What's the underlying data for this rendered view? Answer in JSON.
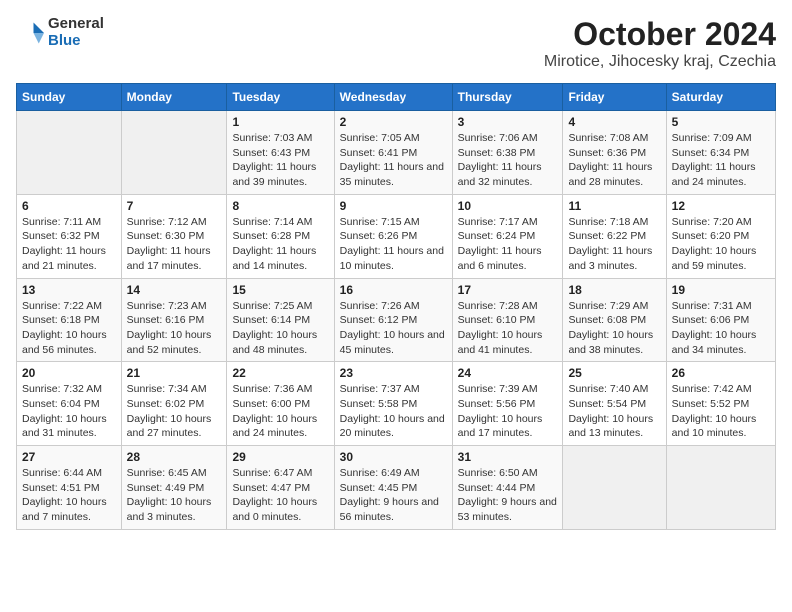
{
  "logo": {
    "general": "General",
    "blue": "Blue"
  },
  "title": "October 2024",
  "subtitle": "Mirotice, Jihocesky kraj, Czechia",
  "days_of_week": [
    "Sunday",
    "Monday",
    "Tuesday",
    "Wednesday",
    "Thursday",
    "Friday",
    "Saturday"
  ],
  "weeks": [
    [
      {
        "num": "",
        "detail": ""
      },
      {
        "num": "",
        "detail": ""
      },
      {
        "num": "1",
        "detail": "Sunrise: 7:03 AM\nSunset: 6:43 PM\nDaylight: 11 hours and 39 minutes."
      },
      {
        "num": "2",
        "detail": "Sunrise: 7:05 AM\nSunset: 6:41 PM\nDaylight: 11 hours and 35 minutes."
      },
      {
        "num": "3",
        "detail": "Sunrise: 7:06 AM\nSunset: 6:38 PM\nDaylight: 11 hours and 32 minutes."
      },
      {
        "num": "4",
        "detail": "Sunrise: 7:08 AM\nSunset: 6:36 PM\nDaylight: 11 hours and 28 minutes."
      },
      {
        "num": "5",
        "detail": "Sunrise: 7:09 AM\nSunset: 6:34 PM\nDaylight: 11 hours and 24 minutes."
      }
    ],
    [
      {
        "num": "6",
        "detail": "Sunrise: 7:11 AM\nSunset: 6:32 PM\nDaylight: 11 hours and 21 minutes."
      },
      {
        "num": "7",
        "detail": "Sunrise: 7:12 AM\nSunset: 6:30 PM\nDaylight: 11 hours and 17 minutes."
      },
      {
        "num": "8",
        "detail": "Sunrise: 7:14 AM\nSunset: 6:28 PM\nDaylight: 11 hours and 14 minutes."
      },
      {
        "num": "9",
        "detail": "Sunrise: 7:15 AM\nSunset: 6:26 PM\nDaylight: 11 hours and 10 minutes."
      },
      {
        "num": "10",
        "detail": "Sunrise: 7:17 AM\nSunset: 6:24 PM\nDaylight: 11 hours and 6 minutes."
      },
      {
        "num": "11",
        "detail": "Sunrise: 7:18 AM\nSunset: 6:22 PM\nDaylight: 11 hours and 3 minutes."
      },
      {
        "num": "12",
        "detail": "Sunrise: 7:20 AM\nSunset: 6:20 PM\nDaylight: 10 hours and 59 minutes."
      }
    ],
    [
      {
        "num": "13",
        "detail": "Sunrise: 7:22 AM\nSunset: 6:18 PM\nDaylight: 10 hours and 56 minutes."
      },
      {
        "num": "14",
        "detail": "Sunrise: 7:23 AM\nSunset: 6:16 PM\nDaylight: 10 hours and 52 minutes."
      },
      {
        "num": "15",
        "detail": "Sunrise: 7:25 AM\nSunset: 6:14 PM\nDaylight: 10 hours and 48 minutes."
      },
      {
        "num": "16",
        "detail": "Sunrise: 7:26 AM\nSunset: 6:12 PM\nDaylight: 10 hours and 45 minutes."
      },
      {
        "num": "17",
        "detail": "Sunrise: 7:28 AM\nSunset: 6:10 PM\nDaylight: 10 hours and 41 minutes."
      },
      {
        "num": "18",
        "detail": "Sunrise: 7:29 AM\nSunset: 6:08 PM\nDaylight: 10 hours and 38 minutes."
      },
      {
        "num": "19",
        "detail": "Sunrise: 7:31 AM\nSunset: 6:06 PM\nDaylight: 10 hours and 34 minutes."
      }
    ],
    [
      {
        "num": "20",
        "detail": "Sunrise: 7:32 AM\nSunset: 6:04 PM\nDaylight: 10 hours and 31 minutes."
      },
      {
        "num": "21",
        "detail": "Sunrise: 7:34 AM\nSunset: 6:02 PM\nDaylight: 10 hours and 27 minutes."
      },
      {
        "num": "22",
        "detail": "Sunrise: 7:36 AM\nSunset: 6:00 PM\nDaylight: 10 hours and 24 minutes."
      },
      {
        "num": "23",
        "detail": "Sunrise: 7:37 AM\nSunset: 5:58 PM\nDaylight: 10 hours and 20 minutes."
      },
      {
        "num": "24",
        "detail": "Sunrise: 7:39 AM\nSunset: 5:56 PM\nDaylight: 10 hours and 17 minutes."
      },
      {
        "num": "25",
        "detail": "Sunrise: 7:40 AM\nSunset: 5:54 PM\nDaylight: 10 hours and 13 minutes."
      },
      {
        "num": "26",
        "detail": "Sunrise: 7:42 AM\nSunset: 5:52 PM\nDaylight: 10 hours and 10 minutes."
      }
    ],
    [
      {
        "num": "27",
        "detail": "Sunrise: 6:44 AM\nSunset: 4:51 PM\nDaylight: 10 hours and 7 minutes."
      },
      {
        "num": "28",
        "detail": "Sunrise: 6:45 AM\nSunset: 4:49 PM\nDaylight: 10 hours and 3 minutes."
      },
      {
        "num": "29",
        "detail": "Sunrise: 6:47 AM\nSunset: 4:47 PM\nDaylight: 10 hours and 0 minutes."
      },
      {
        "num": "30",
        "detail": "Sunrise: 6:49 AM\nSunset: 4:45 PM\nDaylight: 9 hours and 56 minutes."
      },
      {
        "num": "31",
        "detail": "Sunrise: 6:50 AM\nSunset: 4:44 PM\nDaylight: 9 hours and 53 minutes."
      },
      {
        "num": "",
        "detail": ""
      },
      {
        "num": "",
        "detail": ""
      }
    ]
  ]
}
